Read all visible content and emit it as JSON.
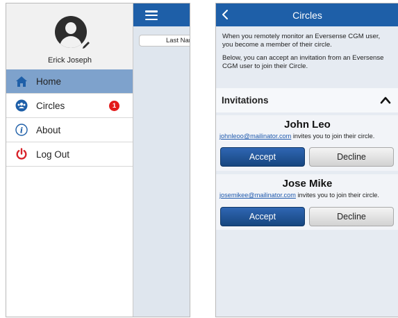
{
  "left_screen": {
    "profile": {
      "name": "Erick Joseph"
    },
    "menu": [
      {
        "label": "Home",
        "icon": "home-icon",
        "active": true
      },
      {
        "label": "Circles",
        "icon": "circles-icon",
        "badge": "1"
      },
      {
        "label": "About",
        "icon": "info-icon"
      },
      {
        "label": "Log Out",
        "icon": "power-icon"
      }
    ],
    "peek": {
      "tab_label": "Last Nar"
    }
  },
  "right_screen": {
    "title": "Circles",
    "intro": [
      "When you remotely monitor an Eversense CGM user, you become a member of their circle.",
      "Below, you can accept an invitation from an Eversense CGM user to join their Circle."
    ],
    "invitations_header": "Invitations",
    "invitations": [
      {
        "name": "John Leo",
        "email": "johnleoo@mailinator.com",
        "message": " invites you to join their circle.",
        "accept_label": "Accept",
        "decline_label": "Decline"
      },
      {
        "name": "Jose Mike",
        "email": "josemikee@mailinator.com",
        "message": " invites you to join their circle.",
        "accept_label": "Accept",
        "decline_label": "Decline"
      }
    ]
  },
  "colors": {
    "header_blue": "#1e5fa8",
    "active_row": "#7ea2cc",
    "badge_red": "#e31b1b",
    "logout_red": "#d8232a",
    "link_blue": "#1f59ad"
  }
}
